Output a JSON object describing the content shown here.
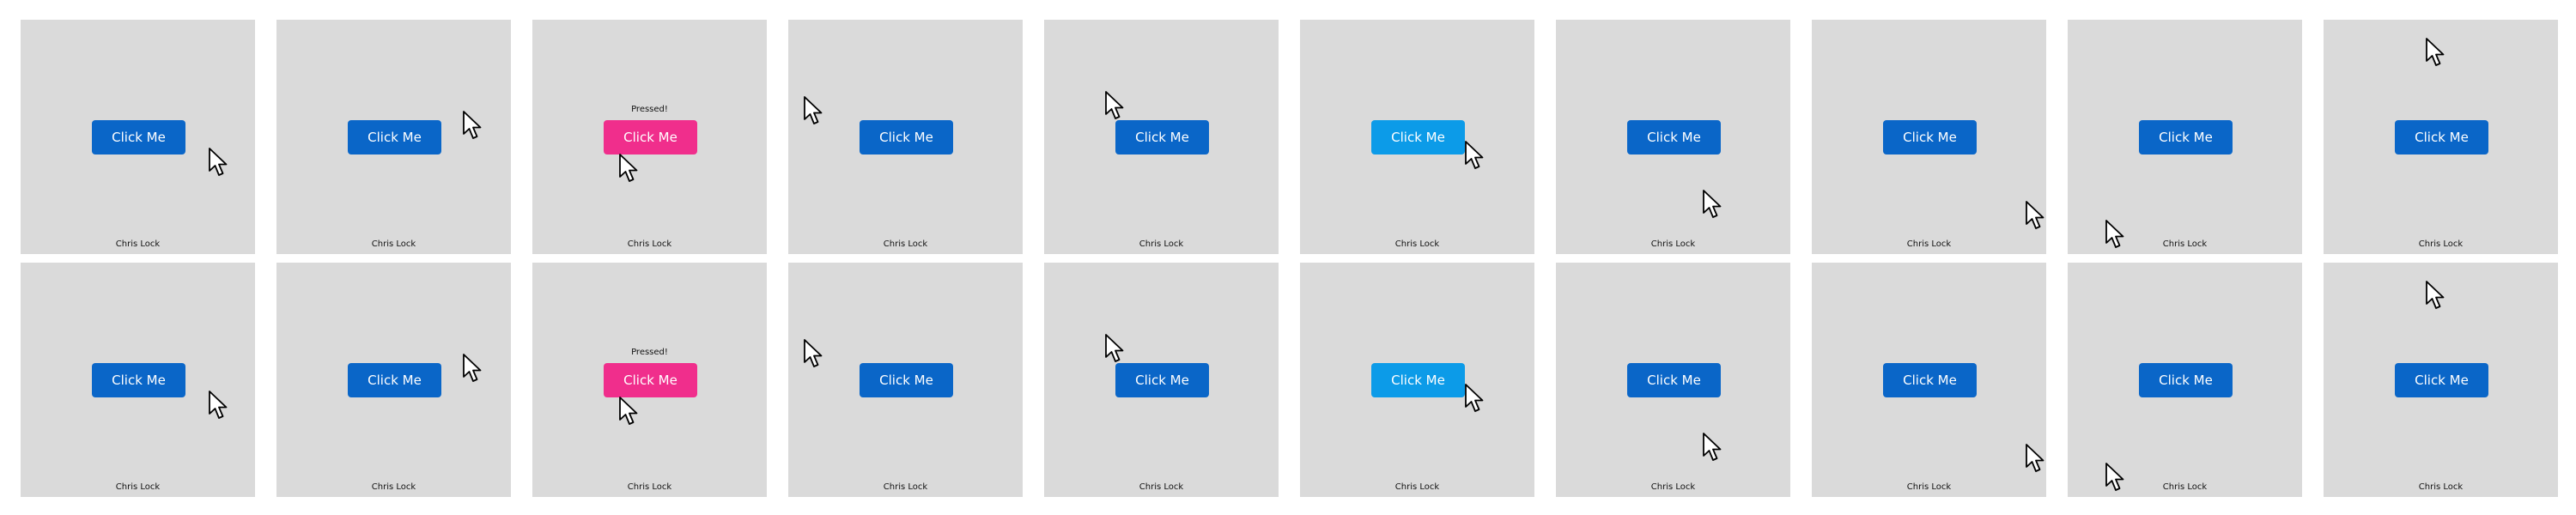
{
  "button_label": "Click Me",
  "pressed_text": "Pressed!",
  "credit_text": "Chris Lock",
  "colors": {
    "frame_bg": "#dadada",
    "button_default": "#0a66c8",
    "button_pressed": "#f02e8c",
    "button_hover": "#0c9be8",
    "cursor_fill": "#ffffff",
    "cursor_stroke": "#000000"
  },
  "cursor_icon": "arrow-pointer-icon",
  "frames": [
    {
      "state": "default"
    },
    {
      "state": "default"
    },
    {
      "state": "pressed"
    },
    {
      "state": "default"
    },
    {
      "state": "default"
    },
    {
      "state": "hover"
    },
    {
      "state": "default"
    },
    {
      "state": "default"
    },
    {
      "state": "default"
    },
    {
      "state": "default"
    },
    {
      "state": "default"
    },
    {
      "state": "default"
    },
    {
      "state": "pressed"
    },
    {
      "state": "default"
    },
    {
      "state": "default"
    },
    {
      "state": "hover"
    },
    {
      "state": "default"
    },
    {
      "state": "default"
    },
    {
      "state": "default"
    },
    {
      "state": "default"
    }
  ]
}
